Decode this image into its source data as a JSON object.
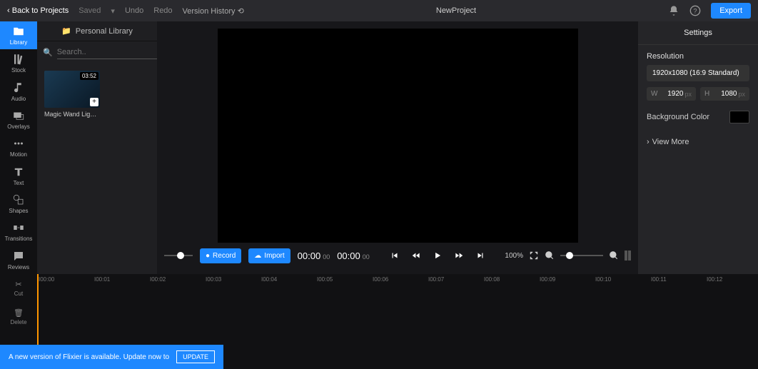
{
  "topbar": {
    "back": "Back to Projects",
    "saved": "Saved",
    "undo": "Undo",
    "redo": "Redo",
    "history": "Version History",
    "project": "NewProject",
    "export": "Export"
  },
  "sidenav": [
    {
      "id": "library",
      "label": "Library"
    },
    {
      "id": "stock",
      "label": "Stock"
    },
    {
      "id": "audio",
      "label": "Audio"
    },
    {
      "id": "overlays",
      "label": "Overlays"
    },
    {
      "id": "motion",
      "label": "Motion"
    },
    {
      "id": "text",
      "label": "Text"
    },
    {
      "id": "shapes",
      "label": "Shapes"
    },
    {
      "id": "transitions",
      "label": "Transitions"
    },
    {
      "id": "reviews",
      "label": "Reviews"
    }
  ],
  "library": {
    "header": "Personal Library",
    "search_placeholder": "Search..",
    "clip": {
      "duration": "03:52",
      "title": "Magic Wand Light..."
    }
  },
  "controls": {
    "record": "Record",
    "import": "Import",
    "time_cur": "00:00",
    "time_cur_sub": "00",
    "time_dur": "00:00",
    "time_dur_sub": "00",
    "zoom": "100%"
  },
  "settings": {
    "title": "Settings",
    "resolution_label": "Resolution",
    "resolution_value": "1920x1080 (16:9 Standard)",
    "w": "W",
    "w_val": "1920",
    "w_unit": "px",
    "h": "H",
    "h_val": "1080",
    "h_unit": "px",
    "bg_label": "Background Color",
    "view_more": "View More"
  },
  "timeline": {
    "tools": [
      {
        "id": "cut",
        "label": "Cut"
      },
      {
        "id": "delete",
        "label": "Delete"
      }
    ],
    "marks": [
      "I00:00",
      "I00:01",
      "I00:02",
      "I00:03",
      "I00:04",
      "I00:05",
      "I00:06",
      "I00:07",
      "I00:08",
      "I00:09",
      "I00:10",
      "I00:11",
      "I00:12"
    ]
  },
  "update": {
    "msg": "A new version of Flixier is available. Update now to",
    "btn": "UPDATE"
  }
}
